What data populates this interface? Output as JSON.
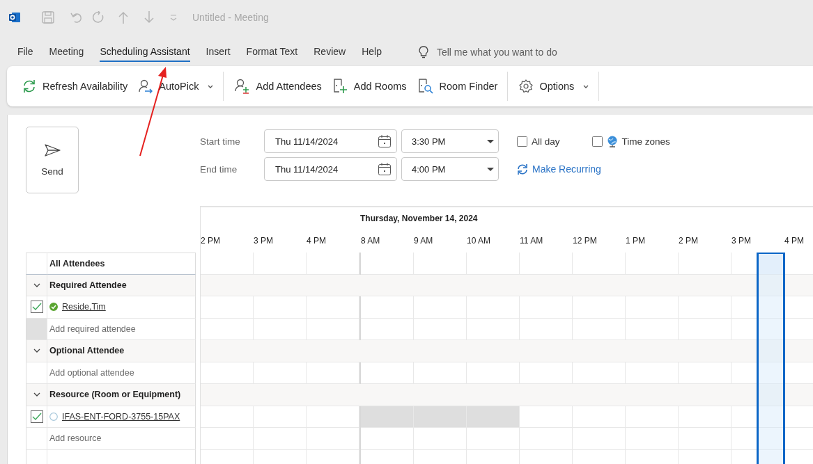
{
  "window": {
    "title": "Untitled - Meeting"
  },
  "tabs": [
    {
      "label": "File",
      "selected": false
    },
    {
      "label": "Meeting",
      "selected": false
    },
    {
      "label": "Scheduling Assistant",
      "selected": true
    },
    {
      "label": "Insert",
      "selected": false
    },
    {
      "label": "Format Text",
      "selected": false
    },
    {
      "label": "Review",
      "selected": false
    },
    {
      "label": "Help",
      "selected": false
    }
  ],
  "tell_me": {
    "placeholder": "Tell me what you want to do"
  },
  "ribbon": {
    "groups": [
      {
        "items": [
          {
            "label": "Refresh Availability",
            "dropdown": false
          },
          {
            "label": "AutoPick",
            "dropdown": true
          }
        ]
      },
      {
        "items": [
          {
            "label": "Add Attendees",
            "dropdown": false
          },
          {
            "label": "Add Rooms",
            "dropdown": false
          },
          {
            "label": "Room Finder",
            "dropdown": false
          }
        ]
      },
      {
        "items": [
          {
            "label": "Options",
            "dropdown": true
          }
        ]
      }
    ]
  },
  "form": {
    "send_button": "Send",
    "start": {
      "label": "Start time",
      "date": "Thu 11/14/2024",
      "time": "3:30 PM"
    },
    "end": {
      "label": "End time",
      "date": "Thu 11/14/2024",
      "time": "4:00 PM"
    },
    "all_day": {
      "label": "All day",
      "checked": false
    },
    "time_zones": {
      "label": "Time zones",
      "checked": false
    },
    "make_recurring": "Make Recurring"
  },
  "schedule": {
    "date_heading": "Thursday, November 14, 2024",
    "hour_groups": [
      {
        "hours": [
          {
            "label": "2 PM",
            "selected": false
          },
          {
            "label": "3 PM",
            "selected": false
          },
          {
            "label": "4 PM",
            "selected": false
          }
        ]
      },
      {
        "hours": [
          {
            "label": "8 AM",
            "selected": false
          },
          {
            "label": "9 AM",
            "selected": false
          },
          {
            "label": "10 AM",
            "selected": false
          },
          {
            "label": "11 AM",
            "selected": false
          },
          {
            "label": "12 PM",
            "selected": false
          },
          {
            "label": "1 PM",
            "selected": false
          },
          {
            "label": "2 PM",
            "selected": false
          },
          {
            "label": "3 PM",
            "selected": true
          },
          {
            "label": "4 PM",
            "selected": false
          }
        ]
      }
    ],
    "rows": [
      {
        "kind": "header",
        "label": "All Attendees"
      },
      {
        "kind": "group",
        "label": "Required Attendee",
        "expanded": true
      },
      {
        "kind": "attendee",
        "name": "Reside,Tim",
        "checked": true,
        "status": {
          "kind": "available"
        },
        "busy": [
          false,
          false,
          false,
          false,
          false,
          false,
          false,
          false,
          false,
          false,
          false,
          false
        ]
      },
      {
        "kind": "add",
        "placeholder": "Add required attendee",
        "selected": true
      },
      {
        "kind": "group",
        "label": "Optional Attendee",
        "expanded": true
      },
      {
        "kind": "add",
        "placeholder": "Add optional attendee",
        "selected": false
      },
      {
        "kind": "group",
        "label": "Resource (Room or Equipment)",
        "expanded": true
      },
      {
        "kind": "attendee",
        "name": "IFAS-ENT-FORD-3755-15PAX",
        "checked": true,
        "status": {
          "kind": "unknown"
        },
        "busy": [
          false,
          false,
          false,
          true,
          true,
          true,
          false,
          false,
          false,
          false,
          false,
          false
        ]
      },
      {
        "kind": "add",
        "placeholder": "Add resource",
        "selected": false
      }
    ]
  }
}
